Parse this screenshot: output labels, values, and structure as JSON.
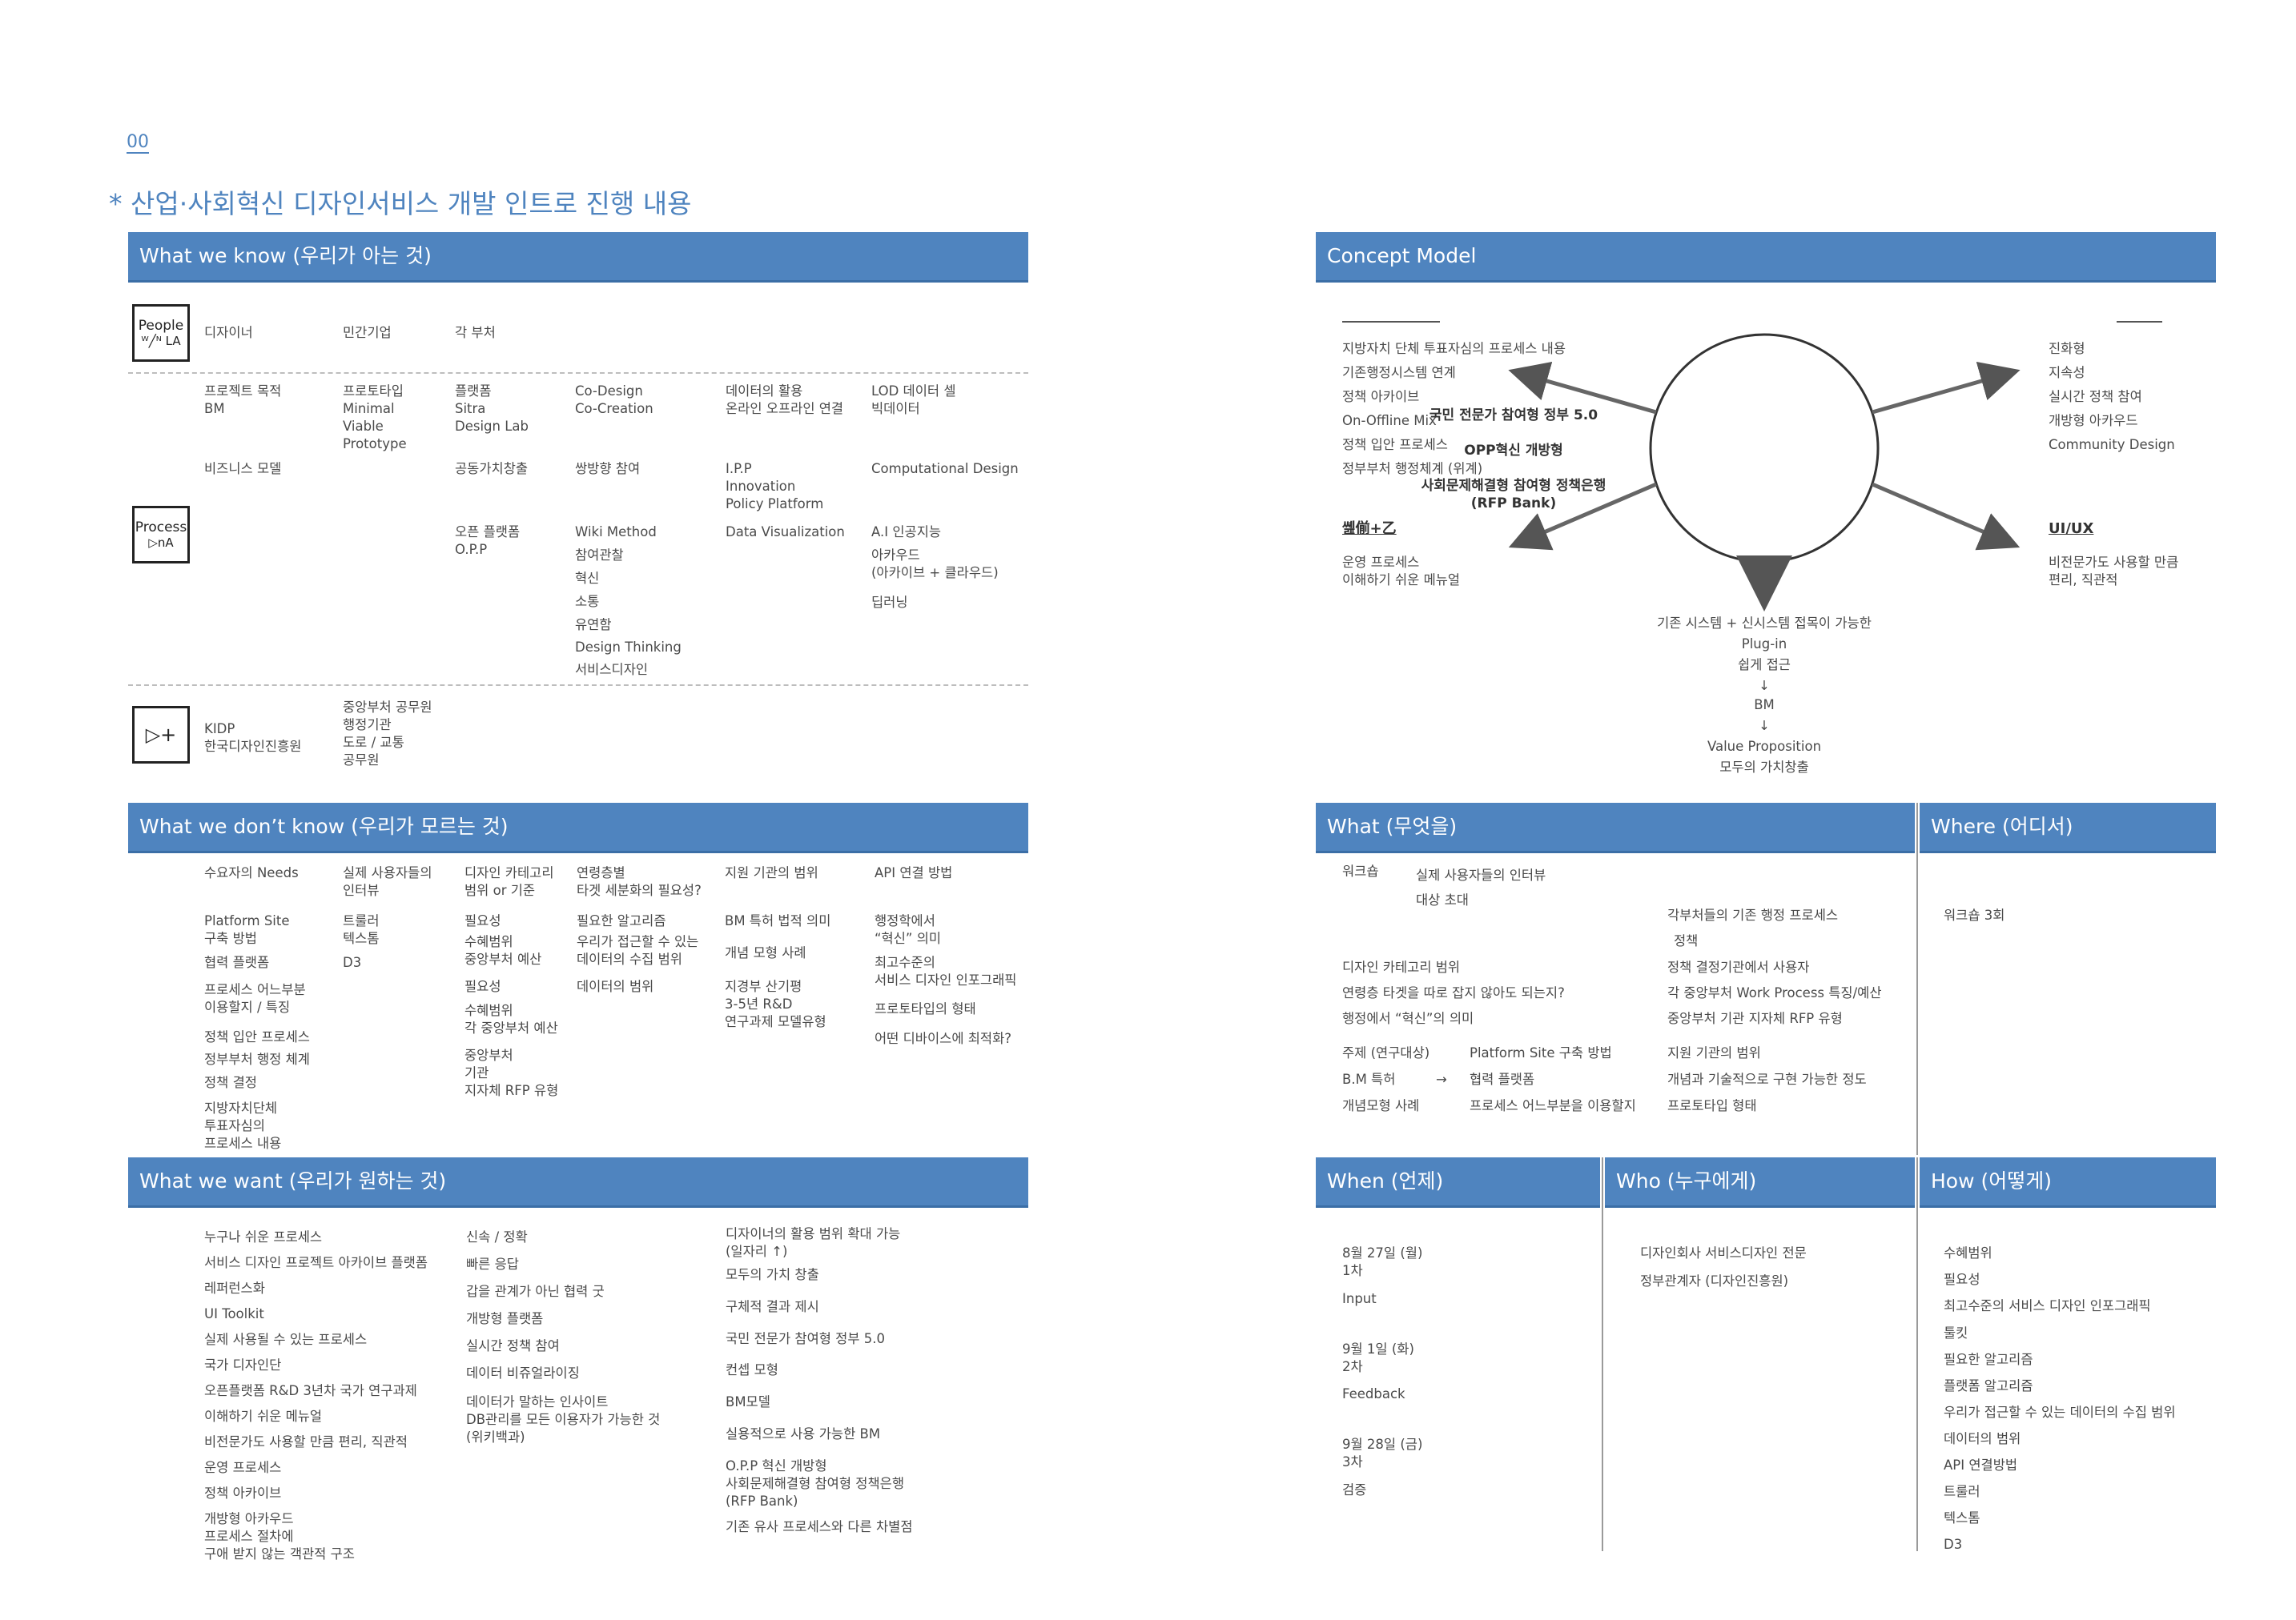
{
  "page_number": "00",
  "title": "* 산업·사회혁신 디자인서비스 개발 인트로 진행 내용",
  "colors": {
    "accent": "#4f84bf",
    "accent_dark": "#3b6ea6",
    "text": "#4a4a4a"
  },
  "know": {
    "header": "What we know (우리가 아는 것)",
    "people_icon": {
      "label": "People",
      "sub": "ᵂ╱ᴺ LA"
    },
    "process_icon": {
      "label": "Process",
      "sub": "▷nA"
    },
    "plus_icon": {
      "label": "▷+"
    },
    "people_row": [
      "디자이너",
      "민간기업",
      "각 부처"
    ],
    "p_r1": [
      "프로젝트 목적\nBM",
      "프로토타입\nMinimal\nViable\nPrototype",
      "플랫폼\nSitra\nDesign Lab",
      "Co-Design\nCo-Creation",
      "데이터의 활용\n온라인 오프라인 연결",
      "LOD 데이터 셀\n빅데이터"
    ],
    "p_r2": [
      "비즈니스 모델",
      "공동가치창출",
      "쌍방향 참여",
      "I.P.P\nInnovation\nPolicy Platform",
      "Computational Design"
    ],
    "p_r3_a": "오픈 플랫폼\nO.P.P",
    "p_r3_b": [
      "Wiki Method",
      "참여관찰",
      "혁신",
      "소통",
      "유연함",
      "Design Thinking",
      "서비스디자인"
    ],
    "p_r3_c": "Data Visualization",
    "p_r3_d": [
      "A.I 인공지능",
      "아카우드\n(아카이브 + 클라우드)",
      "딥러닝"
    ],
    "kidp": "KIDP\n한국디자인진흥원",
    "gov": "중앙부처 공무원\n행정기관\n도로 / 교통\n공무원"
  },
  "dont": {
    "header": "What we don’t know (우리가 모르는 것)",
    "c1": [
      "수요자의 Needs",
      "Platform Site\n구축 방법",
      "협력 플랫폼",
      "프로세스 어느부분\n이용할지 / 특징",
      "정책 입안 프로세스",
      "정부부처 행정 체계",
      "정책 결정",
      "지방자치단체\n투표자심의\n프로세스 내용"
    ],
    "c2": [
      "실제 사용자들의\n인터뷰",
      "트룰러\n텍스톰",
      "D3"
    ],
    "c3": [
      "디자인 카테고리\n범위 or 기준",
      "필요성",
      "수혜범위\n중앙부처 예산",
      "필요성",
      "수혜범위\n각 중앙부처 예산",
      "중앙부처\n기관\n지자체 RFP 유형"
    ],
    "c4": [
      "연령층별\n타겟 세분화의 필요성?",
      "필요한 알고리즘",
      "우리가 접근할 수 있는\n데이터의 수집 범위",
      "데이터의 범위"
    ],
    "c5": [
      "지원 기관의 범위",
      "BM 특허 법적 의미",
      "개념 모형 사례",
      "지경부 산기평\n3-5년 R&D\n연구과제 모델유형"
    ],
    "c6": [
      "API 연결 방법",
      "행정학에서\n“혁신” 의미",
      "최고수준의\n서비스 디자인 인포그래픽",
      "프로토타입의 형태",
      "어떤 디바이스에 최적화?"
    ]
  },
  "want": {
    "header": "What we want (우리가 원하는 것)",
    "c1": [
      "누구나 쉬운 프로세스",
      "서비스 디자인 프로젝트 아카이브 플랫폼",
      "레퍼런스화",
      "UI Toolkit",
      "실제 사용될 수 있는 프로세스",
      "국가 디자인단",
      "오픈플랫폼 R&D 3년차 국가 연구과제",
      "이해하기 쉬운 메뉴얼",
      "비전문가도 사용할 만큼 편리, 직관적",
      "운영 프로세스",
      "정책 아카이브",
      "개방형 아카우드\n프로세스 절차에\n구애 받지 않는 객관적 구조"
    ],
    "c2": [
      "신속 / 정확",
      "빠른 응답",
      "갑을 관계가 아닌 협력 굿",
      "개방형 플랫폼",
      "실시간 정책 참여",
      "데이터 비쥬얼라이징",
      "데이터가 말하는 인사이트\nDB관리를 모든 이용자가 가능한 것\n(위키백과)"
    ],
    "c3": [
      "디자이너의 활용 범위 확대 가능\n(일자리 ↑)",
      "모두의 가치 창출",
      "구체적 결과 제시",
      "국민 전문가 참여형 정부 5.0",
      "컨셉 모형",
      "BM모델",
      "실용적으로 사용 가능한 BM",
      "O.P.P 혁신 개방형\n사회문제해결형 참여형 정책은행\n(RFP Bank)",
      "기존 유사 프로세스와 다른 차별점"
    ]
  },
  "concept": {
    "header": "Concept Model",
    "circle": [
      "국민 전문가 참여형 정부 5.0",
      "OPP혁신 개방형",
      "사회문제해결형 참여형 정책은행\n(RFP Bank)"
    ],
    "tl": [
      "지방자치 단체 투표자심의 프로세스 내용",
      "기존행정시스템 연계",
      "정책 아카이브",
      "On-Offline Mix",
      "정책 입안 프로세스",
      "정부부처 행정체계 (위계)"
    ],
    "tr": [
      "진화형",
      "지속성",
      "실시간 정책 참여",
      "개방형 아카우드",
      "Community Design"
    ],
    "bl_title": "쏊偂+乙",
    "bl": "운영 프로세스\n이해하기 쉬운 메뉴얼",
    "br_title": "UI/UX",
    "br": "비전문가도 사용할 만큼\n편리, 직관적",
    "bottom": [
      "기존 시스템 + 신시스템 접목이 가능한",
      "Plug-in",
      "쉽게 접근",
      "↓",
      "BM",
      "↓",
      "Value Proposition",
      "모두의 가치창출"
    ]
  },
  "what": {
    "header": "What (무엇을)",
    "w1": "워크숍",
    "w1b": "실제 사용자들의 인터뷰\n대상 초대",
    "mid_right": [
      "각부처들의 기존 행정 프로세스",
      "정책",
      "정책 결정기관에서 사용자",
      "각 중앙부처 Work Process 특징/예산",
      "중앙부처 기관 지자체 RFP 유형"
    ],
    "mid_left": [
      "디자인 카테고리 범위",
      "연령층 타겟을 따로 잡지 않아도 되는지?",
      "행정에서 “혁신”의 의미"
    ],
    "low_a": [
      "주제 (연구대상)",
      "B.M 특허",
      "개념모형 사례"
    ],
    "arrow": "→",
    "low_b": [
      "Platform Site 구축 방법",
      "협력 플랫폼",
      "프로세스 어느부분을 이용할지"
    ],
    "low_c": [
      "지원 기관의 범위",
      "개념과 기술적으로 구현 가능한 정도",
      "프로토타입 형태"
    ]
  },
  "where": {
    "header": "Where (어디서)",
    "item": "워크숍 3회"
  },
  "when": {
    "header": "When (언제)",
    "items": [
      "8월 27일 (월)\n1차",
      "Input",
      "9월 1일 (화)\n2차",
      "Feedback",
      "9월 28일 (금)\n3차",
      "검증"
    ]
  },
  "who": {
    "header": "Who (누구에게)",
    "items": [
      "디자인회사 서비스디자인 전문",
      "정부관계자 (디자인진흥원)"
    ]
  },
  "how": {
    "header": "How (어떻게)",
    "items": [
      "수혜범위",
      "필요성",
      "최고수준의 서비스 디자인 인포그래픽",
      "툴킷",
      "필요한 알고리즘",
      "플랫폼 알고리즘",
      "우리가 접근할 수 있는 데이터의 수집 범위",
      "데이터의 범위",
      "API 연결방법",
      "트룰러",
      "텍스톰",
      "D3"
    ]
  }
}
